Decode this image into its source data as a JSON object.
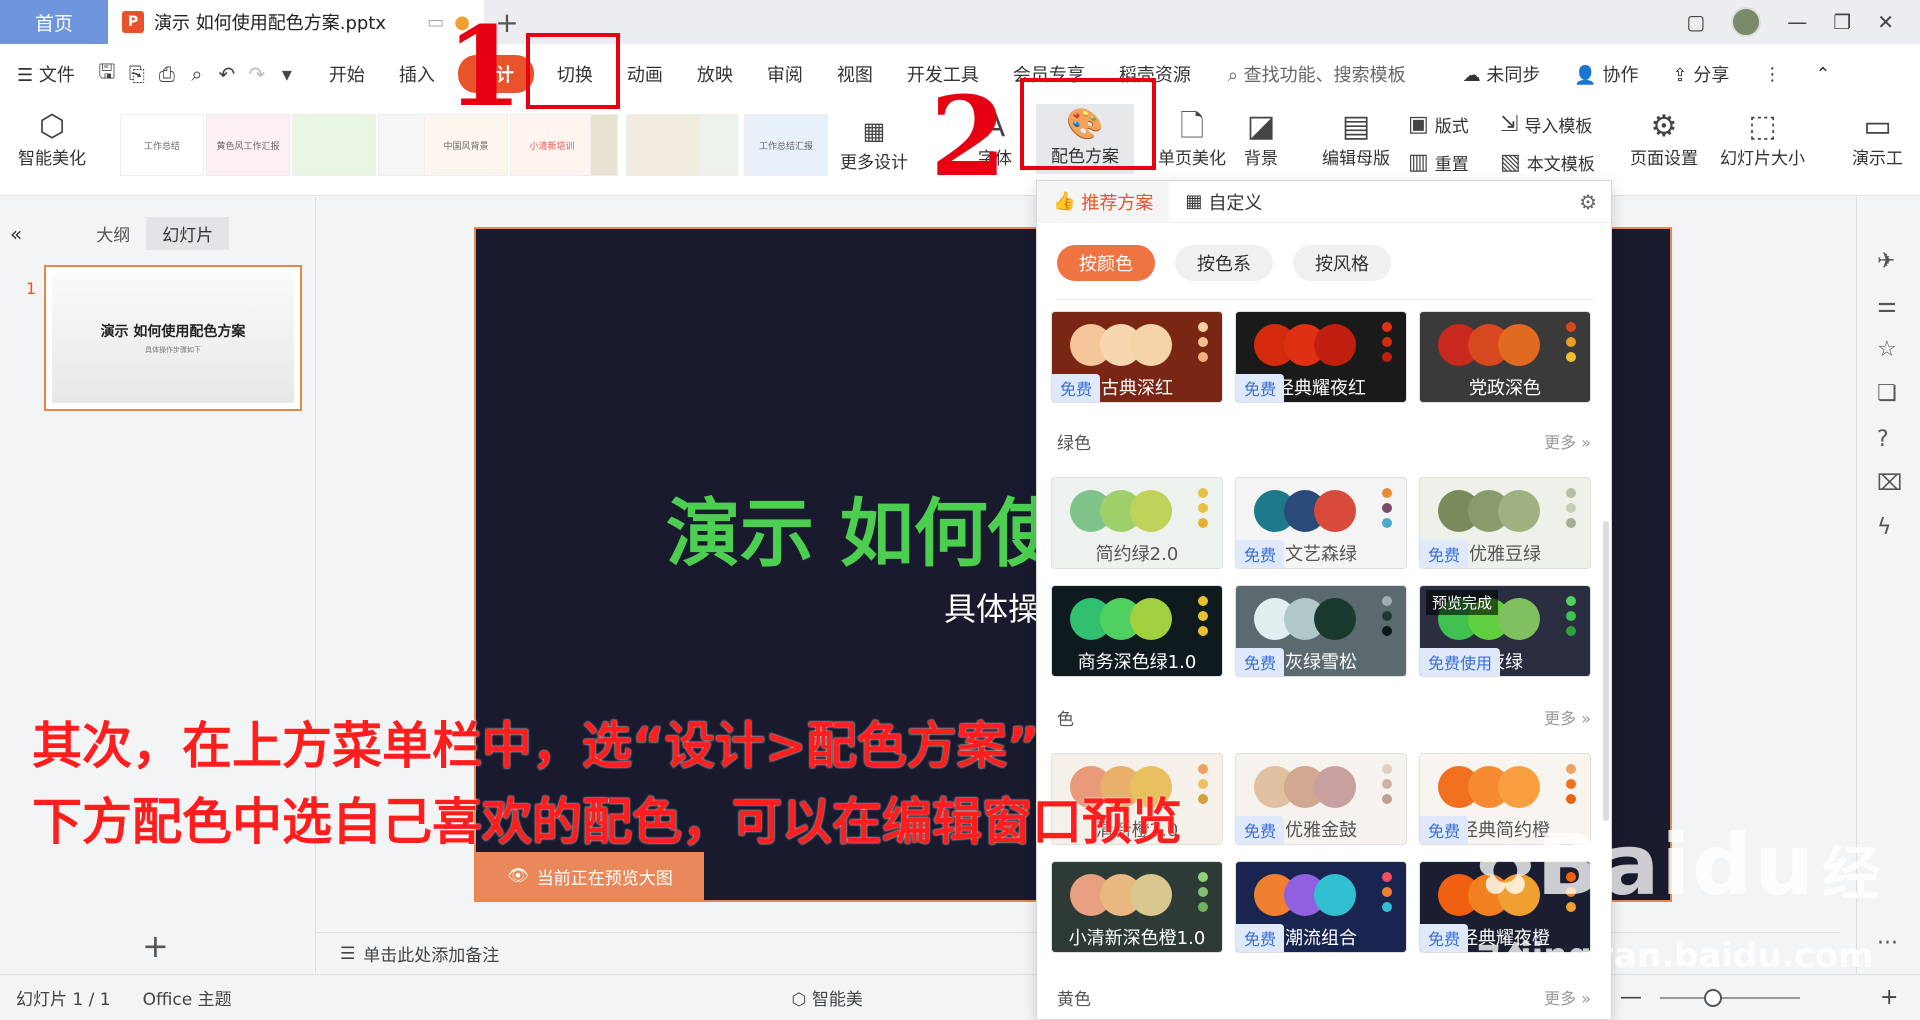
{
  "titlebar": {
    "home_tab": "首页",
    "doc_tab": "演示 如何使用配色方案.pptx",
    "app_icon": "P"
  },
  "menu": {
    "file": "文件",
    "tabs": [
      "开始",
      "插入",
      "设计",
      "切换",
      "动画",
      "放映",
      "审阅",
      "视图",
      "开发工具",
      "会员专享",
      "稻壳资源"
    ],
    "active": "设计",
    "search": "查找功能、搜索模板",
    "sync": "未同步",
    "collab": "协作",
    "share": "分享"
  },
  "ribbon": {
    "smart": "智能美化",
    "more_design": "更多设计",
    "font": "字体",
    "color_scheme": "配色方案",
    "page_beautify": "单页美化",
    "background": "背景",
    "edit_master": "编辑母版",
    "layout": "版式",
    "reset": "重置",
    "import_template": "导入模板",
    "text_template": "本文模板",
    "page_setup": "页面设置",
    "slide_size": "幻灯片大小",
    "present_tool": "演示工",
    "thumbs": [
      "工作总结",
      "黄色风工作汇报",
      "",
      "",
      "中国风背景",
      "小清新培训",
      "",
      "",
      "",
      "工作总结汇报"
    ]
  },
  "leftpane": {
    "tab_outline": "大纲",
    "tab_slides": "幻灯片",
    "slide_no": "1",
    "thumb_title": "演示 如何使用配色方案",
    "thumb_sub": "具体操作步骤如下"
  },
  "slide": {
    "title": "演示 如何使",
    "subtitle": "具体操",
    "preview": "当前正在预览大图"
  },
  "notes": "单击此处添加备注",
  "status": {
    "slide": "幻灯片 1 / 1",
    "theme": "Office 主题",
    "smart": "智能美"
  },
  "dropdown": {
    "tab_recommend": "推荐方案",
    "tab_custom": "自定义",
    "filters": [
      "按颜色",
      "按色系",
      "按风格"
    ],
    "sections": [
      "绿色",
      "色",
      "黄色"
    ],
    "more": "更多",
    "free": "免费",
    "free_use": "免费使用",
    "preview_done": "预览完成",
    "cards": [
      {
        "name": "古典深红",
        "bg": "#7a2614",
        "c": [
          "#f5c69a",
          "#f8d7b0",
          "#f5d5a8"
        ],
        "d": [
          "#f5d0a0",
          "#f5c090",
          "#f0b080"
        ],
        "free": true,
        "nc": "#fff"
      },
      {
        "name": "经典耀夜红",
        "bg": "#1a1a1a",
        "c": [
          "#d42a0e",
          "#e03014",
          "#c01f10"
        ],
        "d": [
          "#e03014",
          "#d02a10",
          "#c02010"
        ],
        "free": true,
        "nc": "#fff"
      },
      {
        "name": "党政深色",
        "bg": "#3a3a3a",
        "c": [
          "#c8281e",
          "#d84820",
          "#e06a20"
        ],
        "d": [
          "#d84820",
          "#e8a020",
          "#f0c030"
        ],
        "free": false,
        "nc": "#fff"
      },
      {
        "name": "简约绿2.0",
        "bg": "#eef2ee",
        "c": [
          "#7fc28a",
          "#9fcf6a",
          "#c1d25a"
        ],
        "d": [
          "#e8c040",
          "#e8c040",
          "#e8b030"
        ],
        "free": false,
        "nc": "#555"
      },
      {
        "name": "文艺森绿",
        "bg": "#f4f4f4",
        "c": [
          "#1e7a8a",
          "#2a4a7a",
          "#d84a3a"
        ],
        "d": [
          "#e88a3a",
          "#7a4a6a",
          "#4aaacc"
        ],
        "free": true,
        "nc": "#555"
      },
      {
        "name": "优雅豆绿",
        "bg": "#eef0ea",
        "c": [
          "#7a8a5a",
          "#8a9a6a",
          "#a0b080"
        ],
        "d": [
          "#b0c0a0",
          "#c0d0b0",
          "#a0b090"
        ],
        "free": true,
        "nc": "#555"
      },
      {
        "name": "商务深色绿1.0",
        "bg": "#0e1a1e",
        "c": [
          "#30c070",
          "#50d060",
          "#a0d040"
        ],
        "d": [
          "#e8c030",
          "#e8c030",
          "#e8c030"
        ],
        "free": false,
        "nc": "#fff"
      },
      {
        "name": "灰绿雪松",
        "bg": "#5a6a6e",
        "c": [
          "#e0f0f0",
          "#b0c8c8",
          "#1a3a30"
        ],
        "d": [
          "#a0b0b0",
          "#1a3a30",
          "#0a1a18"
        ],
        "free": true,
        "nc": "#fff"
      },
      {
        "name": "夜绿",
        "bg": "#2a2e40",
        "c": [
          "#40c050",
          "#60d040",
          "#80c060"
        ],
        "d": [
          "#50d060",
          "#40c050",
          "#30a040"
        ],
        "free": true,
        "nc": "#fff",
        "use": true
      },
      {
        "name": "清新橙2.0",
        "bg": "#f6f0ea",
        "c": [
          "#e89a7a",
          "#e8b06a",
          "#e8c060"
        ],
        "d": [
          "#f0a060",
          "#e8c060",
          "#d0a040"
        ],
        "free": false,
        "nc": "#555"
      },
      {
        "name": "优雅金鼓",
        "bg": "#f6f2ee",
        "c": [
          "#e0c0a0",
          "#d0a890",
          "#c8a0a0"
        ],
        "d": [
          "#e0d0c0",
          "#d0b0a0",
          "#c0a090"
        ],
        "free": true,
        "nc": "#555"
      },
      {
        "name": "经典简约橙",
        "bg": "#f8f4f0",
        "c": [
          "#f07020",
          "#f58a30",
          "#f8a040"
        ],
        "d": [
          "#f0a060",
          "#f07020",
          "#e86010"
        ],
        "free": true,
        "nc": "#555"
      },
      {
        "name": "小清新深色橙1.0",
        "bg": "#2e3a36",
        "c": [
          "#e8a080",
          "#e8b880",
          "#d8c890"
        ],
        "d": [
          "#90d080",
          "#80c070",
          "#70b060"
        ],
        "free": false,
        "nc": "#fff"
      },
      {
        "name": "潮流组合",
        "bg": "#1a2450",
        "c": [
          "#f08030",
          "#9060e0",
          "#30c0d0"
        ],
        "d": [
          "#f05060",
          "#f08030",
          "#30c0d0"
        ],
        "free": true,
        "nc": "#fff"
      },
      {
        "name": "经典耀夜橙",
        "bg": "#1a1e30",
        "c": [
          "#f06010",
          "#f08020",
          "#f0a030"
        ],
        "d": [
          "#f06010",
          "#f08020",
          "#f0a030"
        ],
        "free": true,
        "nc": "#fff"
      }
    ]
  },
  "annotation": {
    "num1": "1",
    "num2": "2",
    "line1": "其次，在上方菜单栏中，选“设计>配色方案”",
    "line2": "下方配色中选自己喜欢的配色，可以在编辑窗口预览"
  },
  "watermark": {
    "brand": "Baidu",
    "cn": "经验",
    "url": "jingyan.baidu.com"
  }
}
